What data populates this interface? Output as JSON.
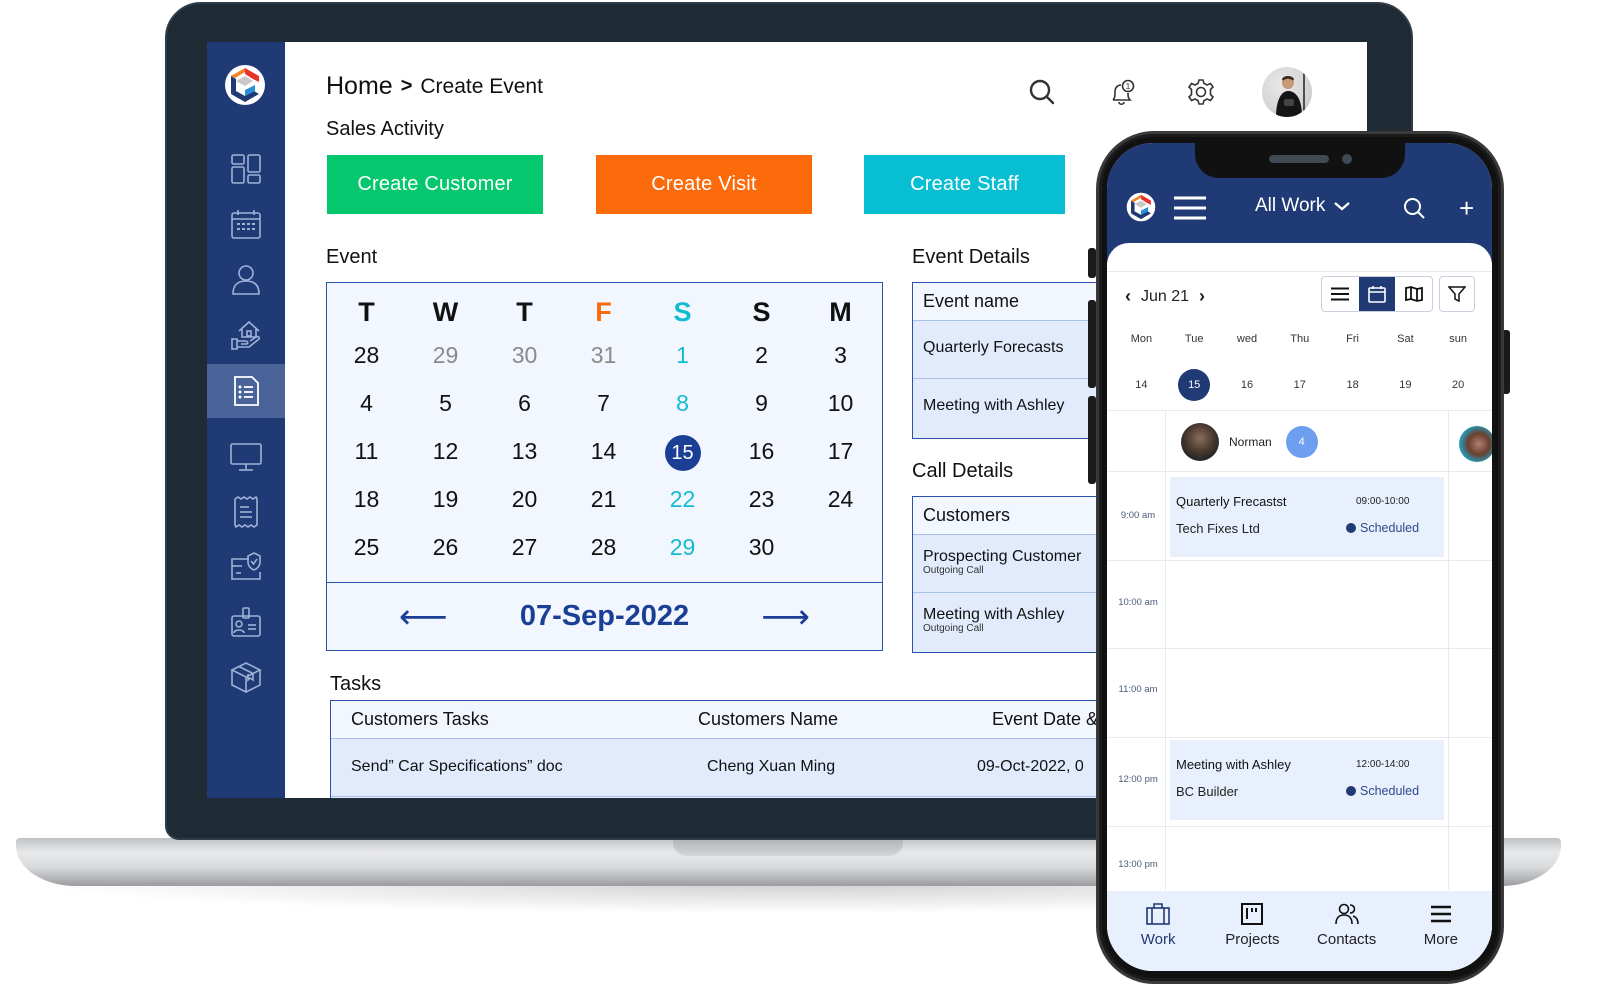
{
  "desktop": {
    "breadcrumb": {
      "home": "Home",
      "separator": ">",
      "current": "Create Event"
    },
    "header_icons": [
      "search-icon",
      "bell-icon",
      "gear-icon",
      "avatar"
    ],
    "notification_count": "1",
    "sidebar": {
      "items": [
        {
          "icon": "dashboard-icon",
          "active": false
        },
        {
          "icon": "calendar-icon",
          "active": false
        },
        {
          "icon": "user-icon",
          "active": false
        },
        {
          "icon": "house-hand-icon",
          "active": false
        },
        {
          "icon": "document-list-icon",
          "active": true
        },
        {
          "icon": "monitor-icon",
          "active": false
        },
        {
          "icon": "receipt-icon",
          "active": false
        },
        {
          "icon": "card-shield-icon",
          "active": false
        },
        {
          "icon": "id-badge-icon",
          "active": false
        },
        {
          "icon": "package-icon",
          "active": false
        }
      ]
    },
    "sales_activity": {
      "title": "Sales Activity",
      "buttons": [
        {
          "label": "Create Customer",
          "color": "#05c86e"
        },
        {
          "label": "Create Visit",
          "color": "#fb6b0c"
        },
        {
          "label": "Create Staff",
          "color": "#08bed3"
        }
      ]
    },
    "event": {
      "title": "Event",
      "weekdays": [
        "T",
        "W",
        "T",
        "F",
        "S",
        "S",
        "M"
      ],
      "weeks": [
        [
          "28",
          "29",
          "30",
          "31",
          "1",
          "2",
          "3"
        ],
        [
          "4",
          "5",
          "6",
          "7",
          "8",
          "9",
          "10"
        ],
        [
          "11",
          "12",
          "13",
          "14",
          "15",
          "16",
          "17"
        ],
        [
          "18",
          "19",
          "20",
          "21",
          "22",
          "23",
          "24"
        ],
        [
          "25",
          "26",
          "27",
          "28",
          "29",
          "30",
          ""
        ]
      ],
      "selected_day": "15",
      "current_date": "07-Sep-2022",
      "prev_label": "⟵",
      "next_label": "⟶",
      "colors": {
        "friday": "#fb6b0c",
        "saturday": "#14bcd1",
        "muted": "#8a8a8a",
        "selected": "#1c3f96"
      }
    },
    "event_details": {
      "title": "Event Details",
      "header": "Event name",
      "rows": [
        "Quarterly Forecasts",
        "Meeting with Ashley"
      ]
    },
    "call_details": {
      "title": "Call Details",
      "header": "Customers",
      "rows": [
        {
          "name": "Prospecting Customer",
          "type": "Outgoing Call"
        },
        {
          "name": "Meeting with Ashley",
          "type": "Outgoing Call"
        }
      ]
    },
    "tasks": {
      "title": "Tasks",
      "columns": [
        "Customers Tasks",
        "Customers Name",
        "Event Date &"
      ],
      "rows": [
        [
          "Send” Car Specifications” doc",
          "Cheng Xuan Ming",
          "09-Oct-2022, 0"
        ]
      ]
    }
  },
  "mobile": {
    "title": "All Work",
    "plus": "+",
    "month_label": "Jun 21",
    "prev": "‹",
    "next": "›",
    "view_modes": [
      "list-icon",
      "calendar-icon",
      "map-icon"
    ],
    "active_view": "calendar-icon",
    "days": [
      {
        "name": "Mon",
        "date": "14"
      },
      {
        "name": "Tue",
        "date": "15",
        "selected": true
      },
      {
        "name": "wed",
        "date": "16"
      },
      {
        "name": "Thu",
        "date": "17"
      },
      {
        "name": "Fri",
        "date": "18"
      },
      {
        "name": "Sat",
        "date": "19"
      },
      {
        "name": "sun",
        "date": "20"
      }
    ],
    "person": {
      "name": "Norman",
      "count": "4"
    },
    "times": [
      "9:00 am",
      "10:00 am",
      "11:00 am",
      "12:00 pm",
      "13:00 pm"
    ],
    "events": [
      {
        "title": "Quarterly Frecastst",
        "time": "09:00-10:00",
        "company": "Tech Fixes Ltd",
        "status": "Scheduled"
      },
      {
        "title": "Meeting with Ashley",
        "time": "12:00-14:00",
        "company": "BC Builder",
        "status": "Scheduled"
      }
    ],
    "tabs": [
      {
        "label": "Work",
        "icon": "briefcase-icon",
        "active": true
      },
      {
        "label": "Projects",
        "icon": "kanban-icon",
        "active": false
      },
      {
        "label": "Contacts",
        "icon": "contacts-icon",
        "active": false
      },
      {
        "label": "More",
        "icon": "menu-icon",
        "active": false
      }
    ]
  },
  "brand": {
    "primary": "#1f3a74",
    "accent_blue": "#1c3f96"
  }
}
